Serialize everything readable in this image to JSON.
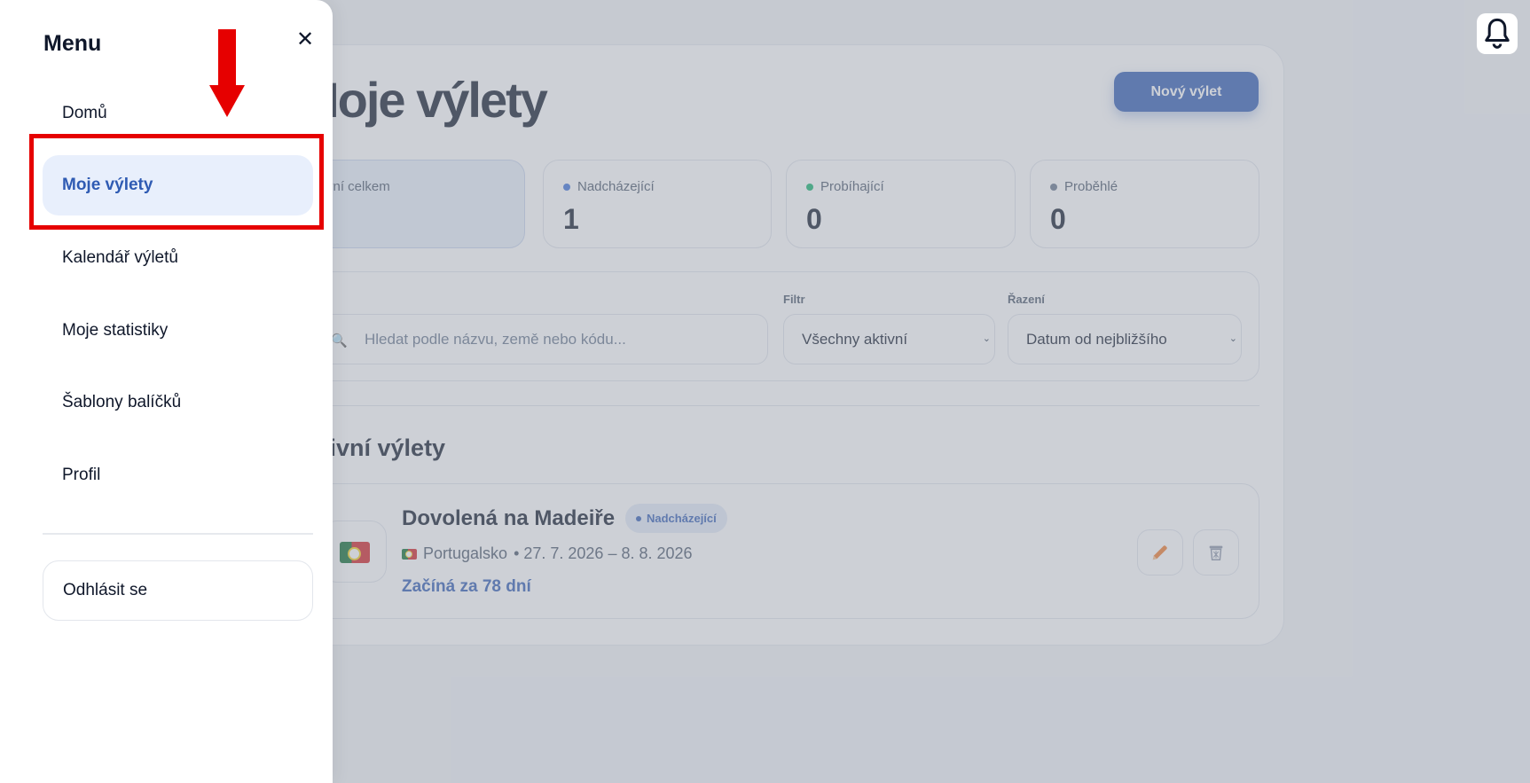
{
  "header": {
    "page_title": "Moje výlety",
    "new_trip_label": "Nový výlet"
  },
  "stats": [
    {
      "label": "Aktivní celkem",
      "value": "",
      "dot_color": ""
    },
    {
      "label": "Nadcházející",
      "value": "1",
      "dot_color": "#3b6fd8"
    },
    {
      "label": "Probíhající",
      "value": "0",
      "dot_color": "#10b26c"
    },
    {
      "label": "Proběhlé",
      "value": "0",
      "dot_color": "#64748b"
    }
  ],
  "filters": {
    "search_placeholder": "Hledat podle názvu, země nebo kódu...",
    "filter_label": "Filtr",
    "filter_value": "Všechny aktivní",
    "sort_label": "Řazení",
    "sort_value": "Datum od nejbližšího"
  },
  "section": {
    "title": "Aktivní výlety"
  },
  "trip": {
    "name": "Dovolená na Madeiře",
    "badge": "Nadcházející",
    "country": "Portugalsko",
    "dates": "• 27. 7. 2026 – 8. 8. 2026",
    "countdown": "Začíná za 78 dní",
    "flag_icon": "portugal-flag-icon"
  },
  "icons": {
    "bell": "bell-icon",
    "close": "✕",
    "search": "🔍",
    "edit": "pencil-icon",
    "delete": "trash-icon"
  },
  "drawer": {
    "title": "Menu",
    "items": [
      {
        "label": "Domů"
      },
      {
        "label": "Moje výlety"
      },
      {
        "label": "Kalendář výletů"
      },
      {
        "label": "Moje statistiky"
      },
      {
        "label": "Šablony balíčků"
      },
      {
        "label": "Profil"
      }
    ],
    "logout_label": "Odhlásit se"
  },
  "colors": {
    "accent": "#2f5bb3",
    "annotation": "#e60000",
    "active_item_bg": "#e8effc"
  }
}
